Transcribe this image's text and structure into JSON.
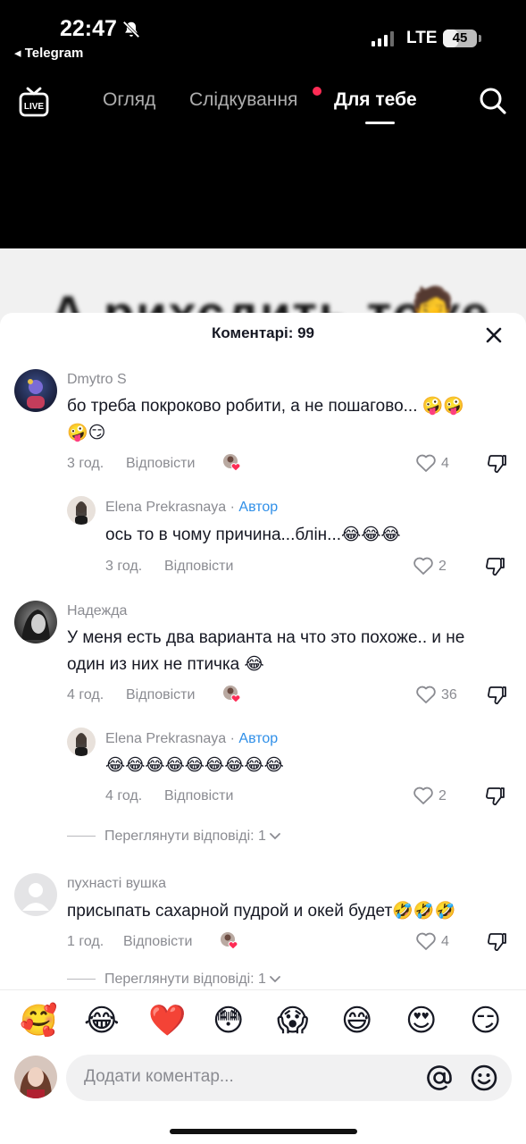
{
  "status_bar": {
    "time": "22:47",
    "back_app": "◂ Telegram",
    "network": "LTE",
    "battery": "45",
    "battery_level_pct": 45
  },
  "top_nav": {
    "live_label": "LIVE",
    "tabs": [
      {
        "label": "Огляд",
        "active": false
      },
      {
        "label": "Слідкування",
        "active": false,
        "has_dot": true
      },
      {
        "label": "Для тебе",
        "active": true
      }
    ],
    "search_icon": "search-icon"
  },
  "video": {
    "caption_peek": "А рихсдить тоже",
    "emoji": "🤦"
  },
  "comments_sheet": {
    "title": "Коментарі: 99",
    "comments": [
      {
        "author": "Dmytro S",
        "text_line1": "бо треба покроково робити, а не пошагово... 🤪🤪",
        "text_line2": "🤪😏",
        "time": "3 год.",
        "reply_label": "Відповісти",
        "likes": "4",
        "replies": [
          {
            "author": "Elena Prekrasnaya",
            "separator": " · ",
            "badge": "Автор",
            "text": "ось то в чому причина...блін...😂😂😂",
            "time": "3 год.",
            "reply_label": "Відповісти",
            "likes": "2"
          }
        ]
      },
      {
        "author": "Надежда",
        "text_line1": "У меня есть два варианта на что это похоже.. и не",
        "text_line2": "один из них не птичка 😂",
        "time": "4 год.",
        "reply_label": "Відповісти",
        "likes": "36",
        "replies": [
          {
            "author": "Elena Prekrasnaya",
            "separator": " · ",
            "badge": "Автор",
            "text": "😂😂😂😂😂😂😂😂😂",
            "time": "4 год.",
            "reply_label": "Відповісти",
            "likes": "2"
          }
        ],
        "view_replies": "Переглянути відповіді: 1"
      },
      {
        "author": "пухнасті вушка",
        "text_line1": "присыпать сахарной пудрой и окей будет🤣🤣🤣",
        "time": "1 год.",
        "reply_label": "Відповісти",
        "likes": "4",
        "view_replies": "Переглянути відповіді: 1"
      }
    ]
  },
  "quick_emojis": [
    "🥰",
    "😂",
    "❤️",
    "😳",
    "😱",
    "😅",
    "😍",
    "😏"
  ],
  "composer": {
    "placeholder": "Додати коментар..."
  },
  "colors": {
    "accent_red": "#fe2c55",
    "author_badge": "#2f8fe8",
    "secondary_text": "#8a8b91"
  }
}
